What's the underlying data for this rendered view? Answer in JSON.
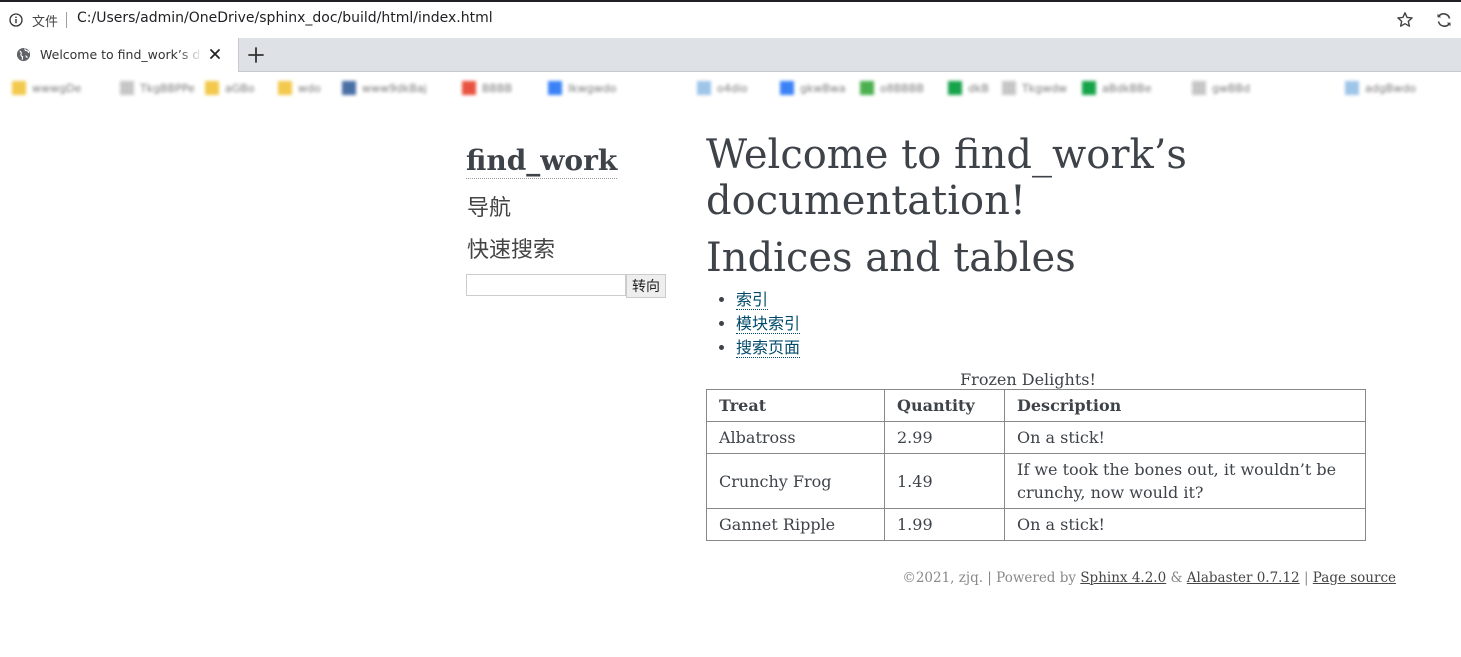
{
  "browser": {
    "scheme_label": "文件",
    "url": "C:/Users/admin/OneDrive/sphinx_doc/build/html/index.html",
    "tab_title": "Welcome to find_work’s documentation!"
  },
  "bookmarks": [
    {
      "label": "wwwgDe",
      "color": "#f2c94c"
    },
    {
      "label": "TkgBBPPe",
      "color": "#c6c6c6"
    },
    {
      "label": "aGBo",
      "color": "#f2c94c"
    },
    {
      "label": "wdo",
      "color": "#f2c94c"
    },
    {
      "label": "www9dkBaj",
      "color": "#4a6fa5"
    },
    {
      "label": "BBBB",
      "color": "#e8533f"
    },
    {
      "label": "Ikwgwdo",
      "color": "#3b82f6"
    },
    {
      "label": "o4dio",
      "color": "#9ec5e8"
    },
    {
      "label": "gkwBwa",
      "color": "#3b82f6"
    },
    {
      "label": "o8BBBB",
      "color": "#4caf50"
    },
    {
      "label": "dkB",
      "color": "#16a34a"
    },
    {
      "label": "Tkgwdw",
      "color": "#c6c6c6"
    },
    {
      "label": "aBdkBBe",
      "color": "#16a34a"
    },
    {
      "label": "gwBBd",
      "color": "#c6c6c6"
    },
    {
      "label": "adgBwdo",
      "color": "#9ec5e8"
    }
  ],
  "sidebar": {
    "logo": "find_work",
    "nav_heading": "导航",
    "search_heading": "快速搜索",
    "search_value": "",
    "go_label": "转向"
  },
  "main": {
    "title": "Welcome to find_work’s documentation!",
    "section_title": "Indices and tables",
    "links": [
      "索引",
      "模块索引",
      "搜索页面"
    ],
    "table": {
      "caption": "Frozen Delights!",
      "headers": [
        "Treat",
        "Quantity",
        "Description"
      ],
      "rows": [
        [
          "Albatross",
          "2.99",
          "On a stick!"
        ],
        [
          "Crunchy Frog",
          "1.49",
          "If we took the bones out, it wouldn’t be crunchy, now would it?"
        ],
        [
          "Gannet Ripple",
          "1.99",
          "On a stick!"
        ]
      ]
    }
  },
  "footer": {
    "copyright": "©2021, zjq.",
    "sep1": "|",
    "powered_by": "Powered by",
    "sphinx_link": "Sphinx 4.2.0",
    "amp": "&",
    "theme_link": "Alabaster 0.7.12",
    "sep2": "|",
    "source_link": "Page source"
  }
}
